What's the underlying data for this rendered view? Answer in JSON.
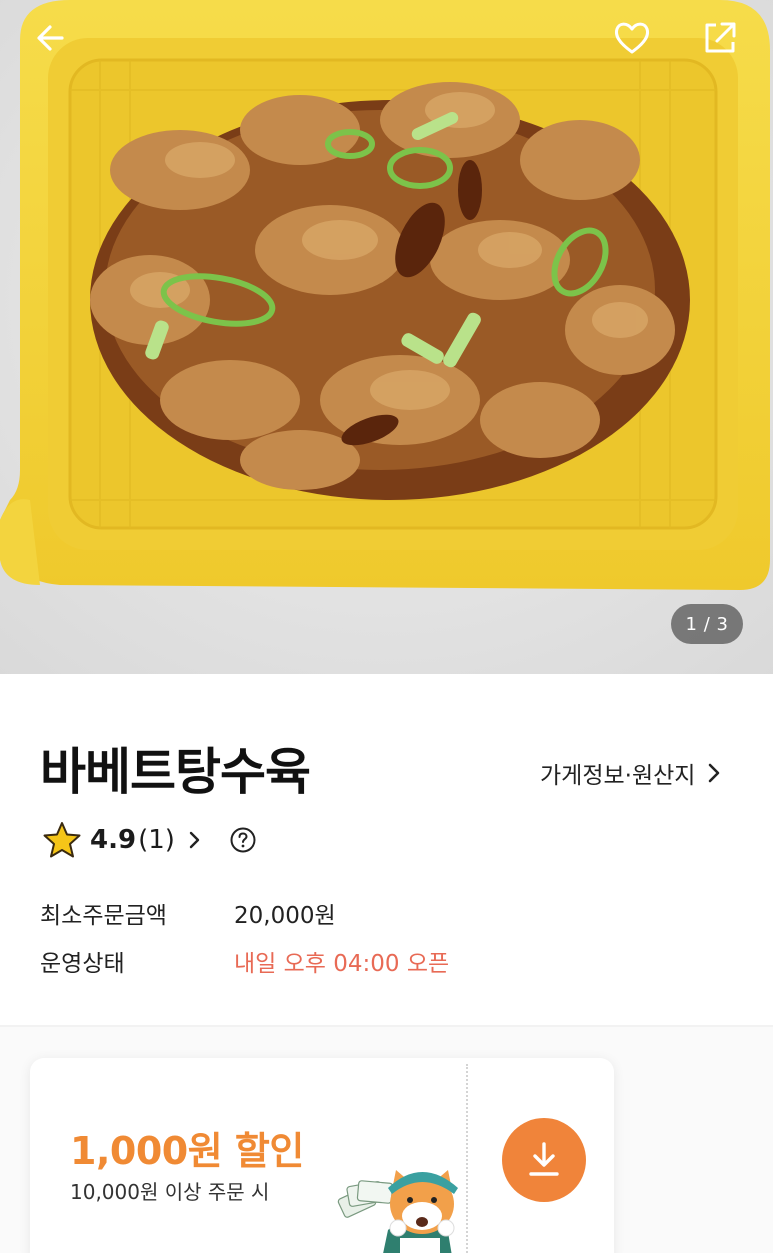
{
  "hero": {
    "image_desc": "photo-of-sweet-and-sour-pork-in-yellow-container",
    "counter": "1 / 3",
    "icons": {
      "back": "back-arrow-icon",
      "favorite": "heart-icon",
      "share": "share-icon"
    }
  },
  "store": {
    "name": "바베트탕수육",
    "info_link": "가게정보·원산지",
    "rating": "4.9",
    "review_count": "(1)",
    "min_order_label": "최소주문금액",
    "min_order_value": "20,000원",
    "status_label": "운영상태",
    "status_value": "내일 오후 04:00 오픈"
  },
  "coupon": {
    "title": "1,000원 할인",
    "condition": "10,000원 이상 주문 시",
    "icon": "download-icon"
  },
  "colors": {
    "accent_orange": "#f0843a",
    "status_red": "#e86a55",
    "star_yellow": "#f5c518",
    "container_yellow": "#f4d33a"
  }
}
